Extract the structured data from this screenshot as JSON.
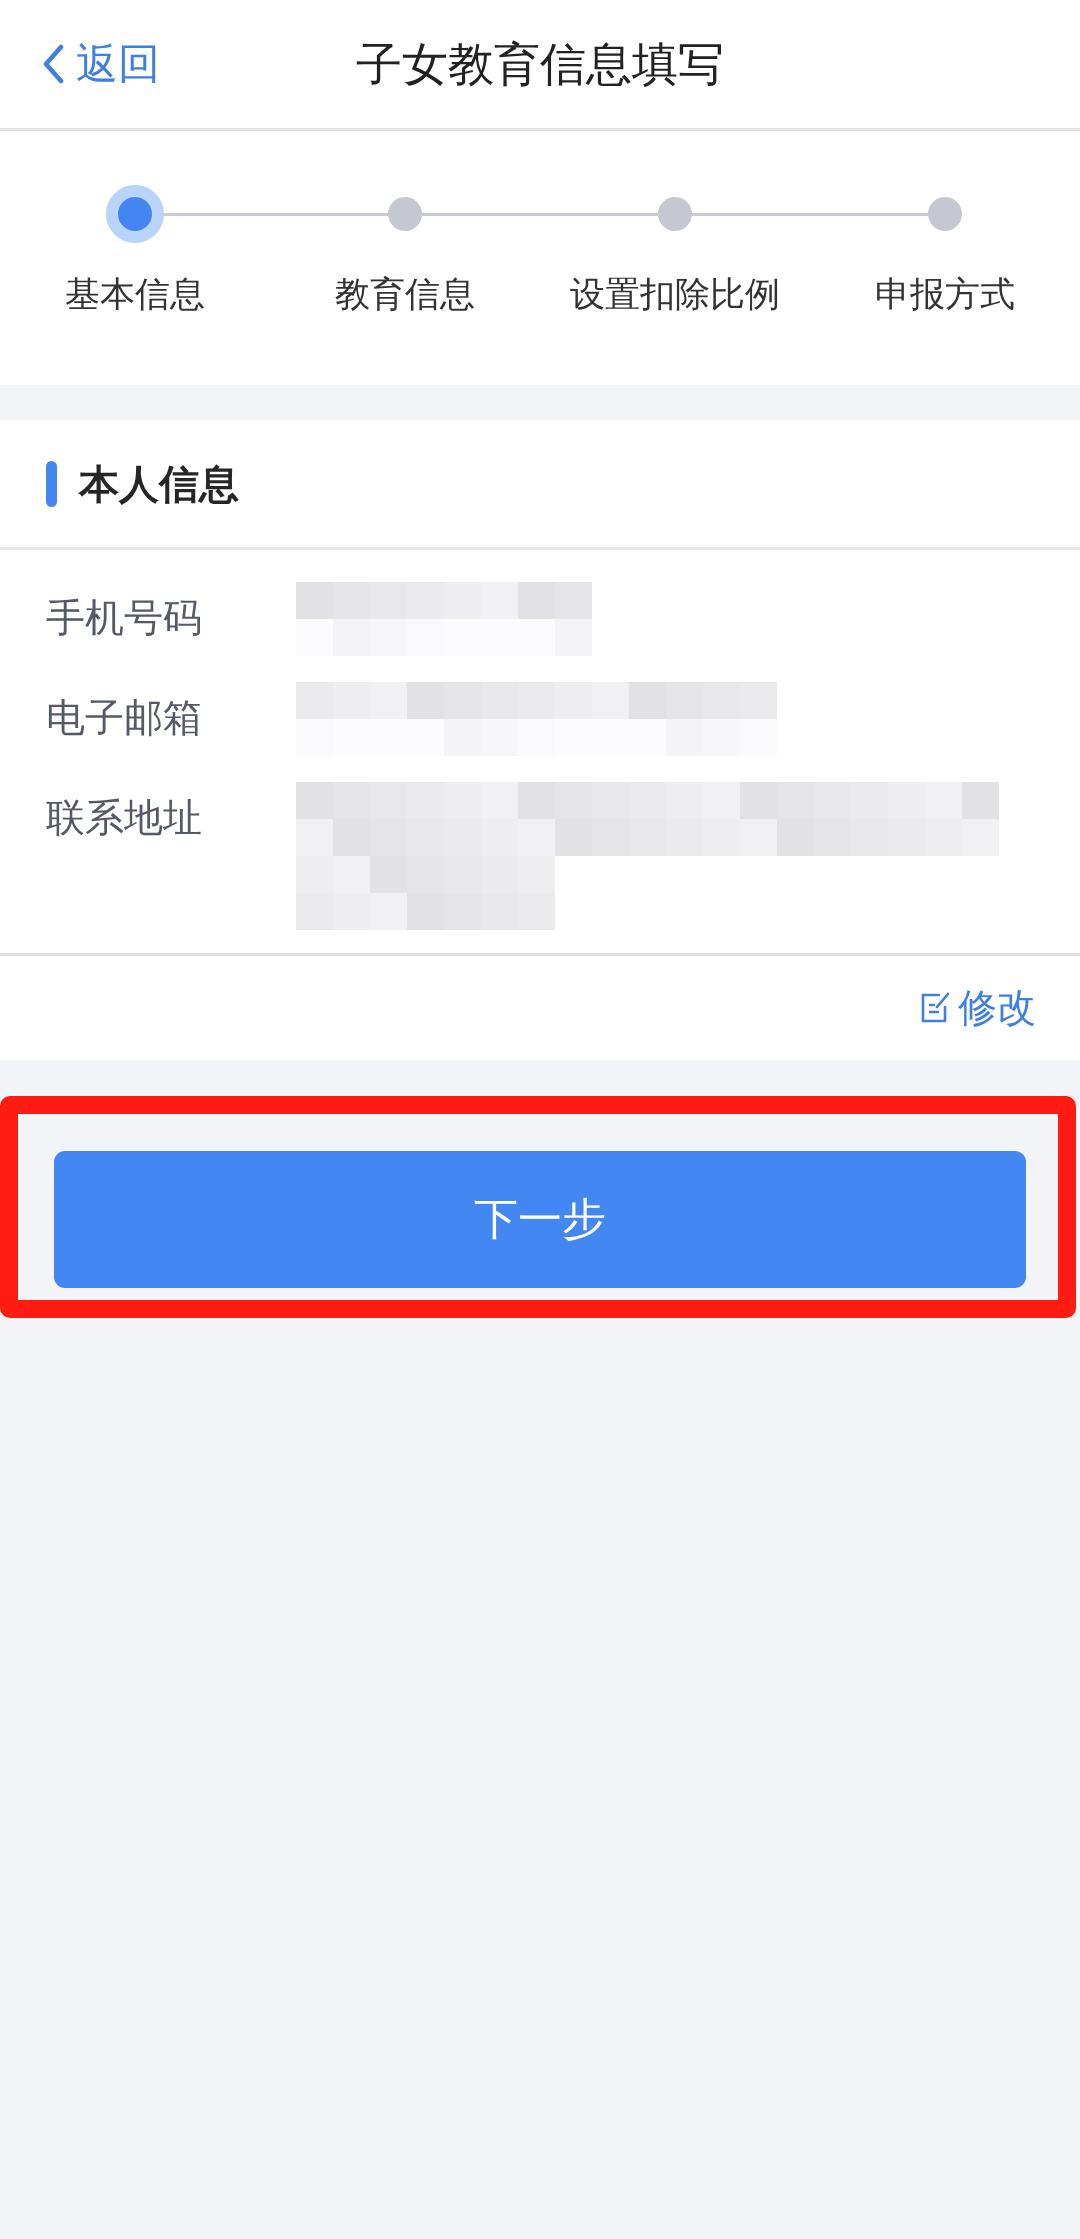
{
  "nav": {
    "back": "返回",
    "title": "子女教育信息填写"
  },
  "steps": [
    {
      "label": "基本信息",
      "selected": true
    },
    {
      "label": "教育信息",
      "selected": false
    },
    {
      "label": "设置扣除比例",
      "selected": false
    },
    {
      "label": "申报方式",
      "selected": false
    }
  ],
  "section": {
    "title": "本人信息",
    "rows": [
      {
        "label": "手机号码",
        "redacted": true
      },
      {
        "label": "电子邮箱",
        "redacted": true
      },
      {
        "label": "联系地址",
        "redacted": true
      }
    ],
    "edit": "修改"
  },
  "next_button": {
    "label": "下一步",
    "highlighted": true
  }
}
